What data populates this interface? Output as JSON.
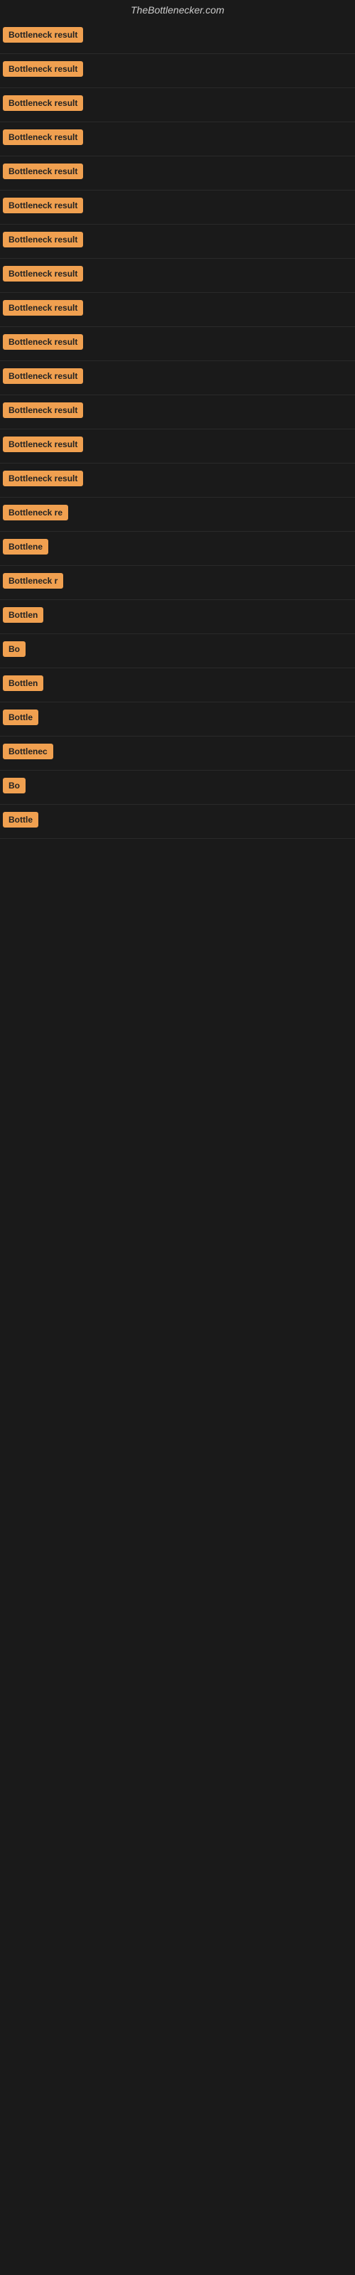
{
  "site": {
    "title": "TheBottlenecker.com"
  },
  "results": [
    {
      "id": 1,
      "label": "Bottleneck result",
      "visible_text": "Bottleneck result"
    },
    {
      "id": 2,
      "label": "Bottleneck result",
      "visible_text": "Bottleneck result"
    },
    {
      "id": 3,
      "label": "Bottleneck result",
      "visible_text": "Bottleneck result"
    },
    {
      "id": 4,
      "label": "Bottleneck result",
      "visible_text": "Bottleneck result"
    },
    {
      "id": 5,
      "label": "Bottleneck result",
      "visible_text": "Bottleneck result"
    },
    {
      "id": 6,
      "label": "Bottleneck result",
      "visible_text": "Bottleneck result"
    },
    {
      "id": 7,
      "label": "Bottleneck result",
      "visible_text": "Bottleneck result"
    },
    {
      "id": 8,
      "label": "Bottleneck result",
      "visible_text": "Bottleneck result"
    },
    {
      "id": 9,
      "label": "Bottleneck result",
      "visible_text": "Bottleneck result"
    },
    {
      "id": 10,
      "label": "Bottleneck result",
      "visible_text": "Bottleneck result"
    },
    {
      "id": 11,
      "label": "Bottleneck result",
      "visible_text": "Bottleneck result"
    },
    {
      "id": 12,
      "label": "Bottleneck result",
      "visible_text": "Bottleneck result"
    },
    {
      "id": 13,
      "label": "Bottleneck result",
      "visible_text": "Bottleneck result"
    },
    {
      "id": 14,
      "label": "Bottleneck result",
      "visible_text": "Bottleneck result"
    },
    {
      "id": 15,
      "label": "Bottleneck re",
      "visible_text": "Bottleneck re"
    },
    {
      "id": 16,
      "label": "Bottlene",
      "visible_text": "Bottlene"
    },
    {
      "id": 17,
      "label": "Bottleneck r",
      "visible_text": "Bottleneck r"
    },
    {
      "id": 18,
      "label": "Bottlen",
      "visible_text": "Bottlen"
    },
    {
      "id": 19,
      "label": "Bo",
      "visible_text": "Bo"
    },
    {
      "id": 20,
      "label": "Bottlen",
      "visible_text": "Bottlen"
    },
    {
      "id": 21,
      "label": "Bottle",
      "visible_text": "Bottle"
    },
    {
      "id": 22,
      "label": "Bottlenec",
      "visible_text": "Bottlenec"
    },
    {
      "id": 23,
      "label": "Bo",
      "visible_text": "Bo"
    },
    {
      "id": 24,
      "label": "Bottle",
      "visible_text": "Bottle"
    }
  ],
  "colors": {
    "badge_bg": "#f0a050",
    "badge_text": "#222222",
    "page_bg": "#1a1a1a",
    "site_title": "#cccccc"
  }
}
